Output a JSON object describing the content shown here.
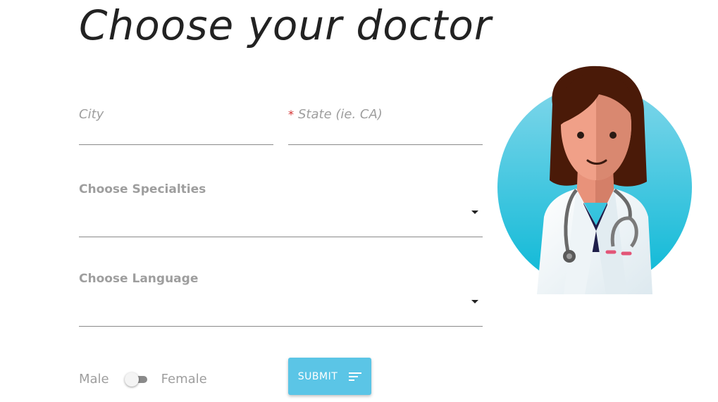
{
  "page": {
    "title": "Choose your doctor"
  },
  "form": {
    "city": {
      "label": "City",
      "value": ""
    },
    "state": {
      "required_mark": "*",
      "label": "State (ie. CA)",
      "value": ""
    },
    "specialties": {
      "label": "Choose Specialties",
      "selected": ""
    },
    "language": {
      "label": "Choose Language",
      "selected": ""
    },
    "gender": {
      "left_label": "Male",
      "right_label": "Female",
      "toggle_on": false
    },
    "submit_label": "SUBMIT"
  },
  "icons": {
    "dropdown": "caret-down-icon",
    "submit": "sort-icon"
  },
  "colors": {
    "accent": "#5bc5e6",
    "required": "#d32f2f",
    "circle_top": "#7fd6ea",
    "circle_bottom": "#0ab8d6"
  }
}
